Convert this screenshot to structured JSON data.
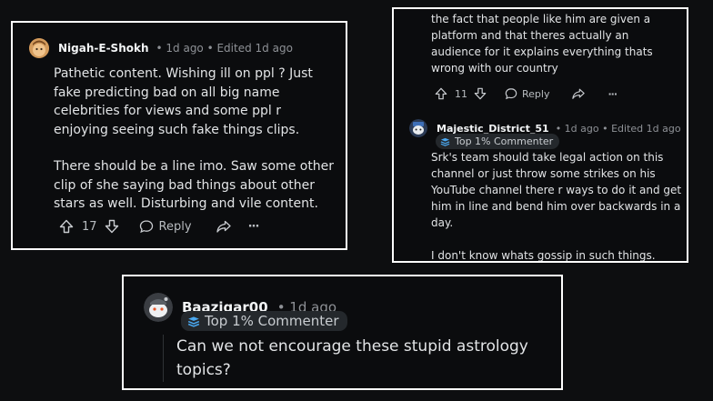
{
  "comments": [
    {
      "username": "Nigah-E-Shokh",
      "meta": "• 1d ago • Edited 1d ago",
      "paragraphs": [
        "Pathetic content. Wishing ill on ppl ? Just fake predicting bad on all big name celebrities for views and some ppl r enjoying seeing such fake things clips.",
        "There should be a line imo. Saw some other clip of she saying bad things about other stars as well. Disturbing and vile content."
      ],
      "votes": "17",
      "reply_label": "Reply",
      "more_label": "···"
    },
    {
      "parent_excerpt": "the fact that people like him are given a platform and that theres actually an audience for it explains everything thats wrong with our country",
      "parent_votes": "11",
      "parent_reply_label": "Reply",
      "parent_more_label": "···",
      "username": "Majestic_District_51",
      "meta": "• 1d ago • Edited 1d ago",
      "badge": "Top 1% Commenter",
      "paragraphs": [
        "Srk's team should take legal action on this channel or just throw some strikes on his YouTube channel there r ways to do it and get him in line and bend him over backwards in a day.",
        "I don't know whats gossip in such things."
      ]
    },
    {
      "username": "Baazigar00",
      "meta": "• 1d ago",
      "badge": "Top 1% Commenter",
      "paragraphs": [
        "Can we not encourage these stupid astrology topics?"
      ]
    }
  ],
  "icons": {
    "upvote": "arrow-up-icon",
    "downvote": "arrow-down-icon",
    "reply": "speech-bubble-icon",
    "share": "share-arrow-icon",
    "badge": "stack-badge-icon"
  },
  "colors": {
    "background": "#0d0e10",
    "panel_border": "#ffffff",
    "text": "#e2e4e6",
    "muted": "#8e9196",
    "badge_bg": "#24282c",
    "badge_icon": "#4aa8f0"
  }
}
